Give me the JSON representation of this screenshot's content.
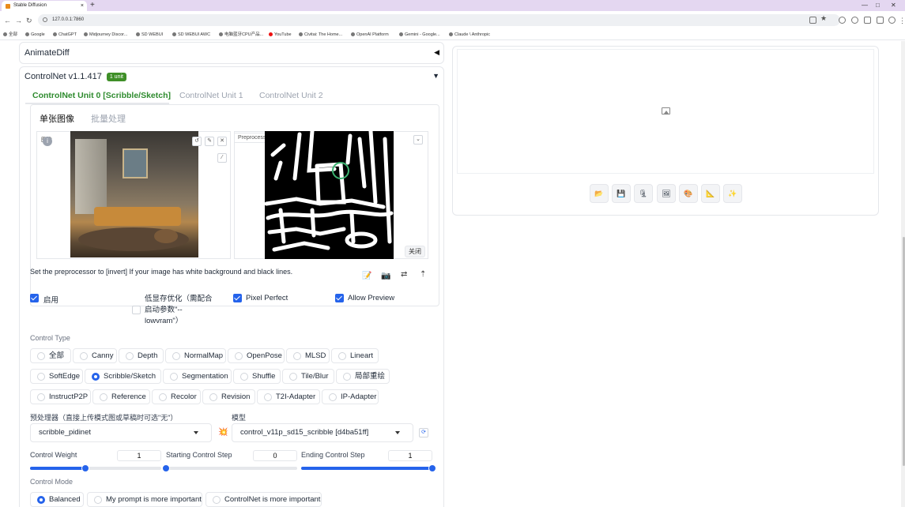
{
  "browser": {
    "tab_title": "Stable Diffusion",
    "new_tab": "+",
    "url": "127.0.0.1:7860",
    "bookmarks": [
      "全部",
      "Google",
      "ChatGPT",
      "Midjourney Discor...",
      "SD WEBUI",
      "SD WEBUI AWC",
      "电脑蓝牙CPU产品...",
      "YouTube",
      "Civitai: The Home...",
      "OpenAI Platform",
      "Gemini - Google...",
      "Claude \\ Anthropic"
    ]
  },
  "accordions": {
    "animatediff": "AnimateDiff",
    "controlnet": "ControlNet v1.1.417",
    "controlnet_badge": "1 unit"
  },
  "unit_tabs": [
    "ControlNet Unit 0 [Scribble/Sketch]",
    "ControlNet Unit 1",
    "ControlNet Unit 2"
  ],
  "image_tabs": [
    "单张图像",
    "批量处理"
  ],
  "image_label": "图像",
  "preview_label": "Preprocessor Preview",
  "close_label": "关闭",
  "tip": "Set the preprocessor to [invert] If your image has white background and black lines.",
  "checkboxes": {
    "enable": {
      "label": "启用",
      "checked": true
    },
    "lowvram": {
      "label_lines": [
        "低显存优化（需配合",
        "启动参数\"--",
        "lowvram\"）"
      ],
      "checked": false
    },
    "pixel_perfect": {
      "label": "Pixel Perfect",
      "checked": true
    },
    "allow_preview": {
      "label": "Allow Preview",
      "checked": true
    }
  },
  "control_type": {
    "label": "Control Type",
    "rows": [
      [
        "全部",
        "Canny",
        "Depth",
        "NormalMap",
        "OpenPose",
        "MLSD",
        "Lineart"
      ],
      [
        "SoftEdge",
        "Scribble/Sketch",
        "Segmentation",
        "Shuffle",
        "Tile/Blur",
        "局部重绘"
      ],
      [
        "InstructP2P",
        "Reference",
        "Recolor",
        "Revision",
        "T2I-Adapter",
        "IP-Adapter"
      ]
    ],
    "selected": "Scribble/Sketch"
  },
  "preprocessor": {
    "label": "预处理器（直接上传模式图或草稿时可选\"无\"）",
    "value": "scribble_pidinet"
  },
  "model": {
    "label": "模型",
    "value": "control_v11p_sd15_scribble [d4ba51ff]"
  },
  "sliders": {
    "weight": {
      "label": "Control Weight",
      "value": "1",
      "fraction": 0.42
    },
    "start": {
      "label": "Starting Control Step",
      "value": "0",
      "fraction": 0.0
    },
    "end": {
      "label": "Ending Control Step",
      "value": "1",
      "fraction": 1.0
    }
  },
  "control_mode": {
    "label": "Control Mode",
    "options": [
      "Balanced",
      "My prompt is more important",
      "ControlNet is more important"
    ],
    "selected": "Balanced"
  },
  "output_actions": [
    "folder-icon",
    "save-icon",
    "zip-icon",
    "image-icon",
    "palette-icon",
    "ruler-icon",
    "sparkle-icon"
  ],
  "colors": {
    "accent": "#2563eb",
    "active_tab": "#2e8b2e",
    "badge": "#3f8f28"
  }
}
